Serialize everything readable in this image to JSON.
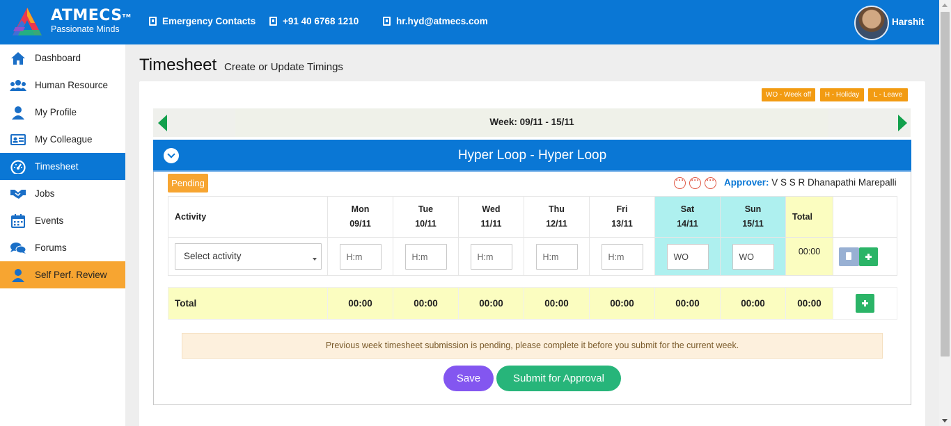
{
  "header": {
    "brand_name": "ATMECS",
    "brand_tagline": "Passionate Minds",
    "emergency_label": "Emergency Contacts",
    "phone": "+91 40 6768 1210",
    "email": "hr.hyd@atmecs.com",
    "user_name": "Harshit",
    "accent_color": "#0a77d5"
  },
  "sidebar": {
    "items": [
      {
        "label": "Dashboard",
        "icon": "home-icon"
      },
      {
        "label": "Human Resource",
        "icon": "users-icon"
      },
      {
        "label": "My Profile",
        "icon": "user-icon"
      },
      {
        "label": "My Colleague",
        "icon": "id-card-icon"
      },
      {
        "label": "Timesheet",
        "icon": "gauge-icon",
        "active": true
      },
      {
        "label": "Jobs",
        "icon": "handshake-icon"
      },
      {
        "label": "Events",
        "icon": "calendar-icon"
      },
      {
        "label": "Forums",
        "icon": "comments-icon"
      },
      {
        "label": "Self Perf. Review",
        "icon": "user-icon",
        "highlight_color": "#f7a531"
      }
    ]
  },
  "page": {
    "title": "Timesheet",
    "subtitle": "Create or Update Timings"
  },
  "legend": {
    "week_off": "WO - Week off",
    "holiday": "H - Holiday",
    "leave": "L - Leave",
    "color": "#f29b12"
  },
  "week": {
    "label": "Week: 09/11 - 15/11"
  },
  "project": {
    "title": "Hyper Loop - Hyper Loop",
    "status": "Pending",
    "approver_label": "Approver:",
    "approver_name": "V S S R Dhanapathi Marepalli"
  },
  "table": {
    "activity_header": "Activity",
    "total_header": "Total",
    "days": [
      {
        "day": "Mon",
        "date": "09/11",
        "placeholder": "H:m",
        "total": "00:00",
        "weekend": false
      },
      {
        "day": "Tue",
        "date": "10/11",
        "placeholder": "H:m",
        "total": "00:00",
        "weekend": false
      },
      {
        "day": "Wed",
        "date": "11/11",
        "placeholder": "H:m",
        "total": "00:00",
        "weekend": false
      },
      {
        "day": "Thu",
        "date": "12/11",
        "placeholder": "H:m",
        "total": "00:00",
        "weekend": false
      },
      {
        "day": "Fri",
        "date": "13/11",
        "placeholder": "H:m",
        "total": "00:00",
        "weekend": false
      },
      {
        "day": "Sat",
        "date": "14/11",
        "placeholder": "WO",
        "total": "00:00",
        "weekend": true
      },
      {
        "day": "Sun",
        "date": "15/11",
        "placeholder": "WO",
        "total": "00:00",
        "weekend": true
      }
    ],
    "select_activity": "Select activity",
    "row_total": "00:00",
    "total_label": "Total",
    "grand_total": "00:00"
  },
  "alert": {
    "message": "Previous week timesheet submission is pending, please complete it before you submit for the current week."
  },
  "actions": {
    "save": "Save",
    "submit": "Submit for Approval"
  }
}
